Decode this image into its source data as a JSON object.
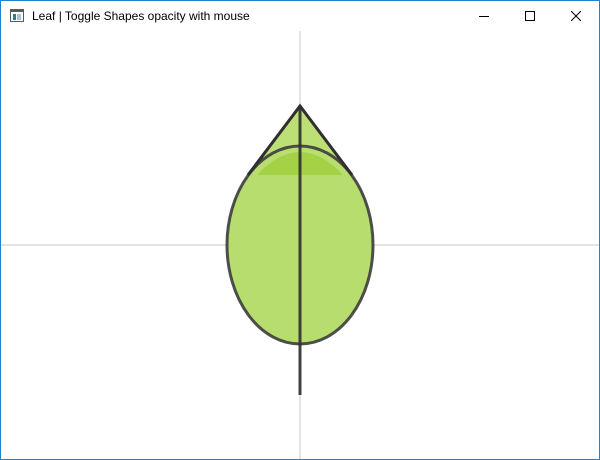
{
  "window": {
    "title": "Leaf | Toggle Shapes opacity with mouse",
    "controls": {
      "minimize": "minimize-icon",
      "maximize": "maximize-icon",
      "close": "close-icon"
    }
  },
  "colors": {
    "border": "#1883d7",
    "axis": "#c8c8c8",
    "leaf_fill": "#b8dd6f",
    "leaf_fill_overlap": "#a0d040",
    "outline": "#3c3c3c"
  },
  "icons": {
    "app": "app-window-icon"
  }
}
